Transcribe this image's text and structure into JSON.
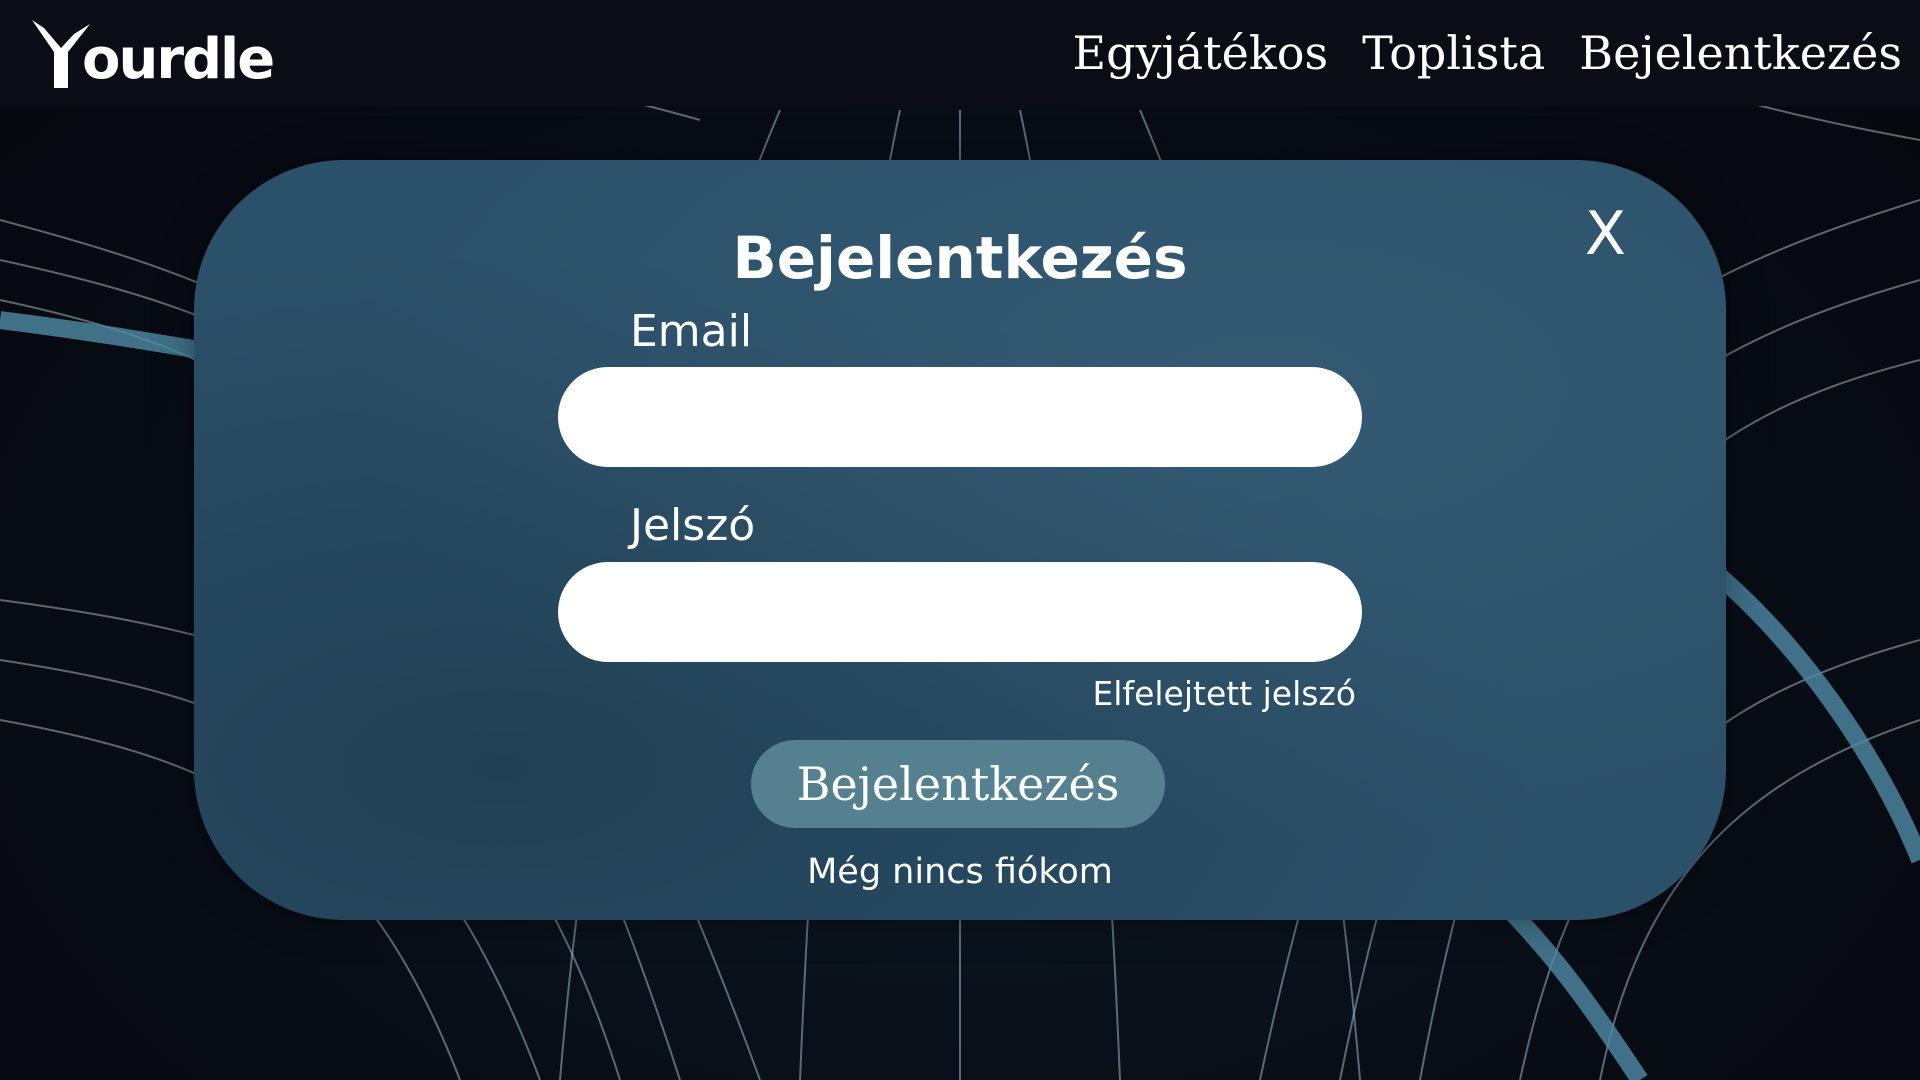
{
  "nav": {
    "logo_text": "ourdle",
    "links": [
      "Egyjátékos",
      "Toplista",
      "Bejelentkezés"
    ]
  },
  "modal": {
    "title": "Bejelentkezés",
    "close_label": "X",
    "email_label": "Email",
    "email_value": "",
    "password_label": "Jelszó",
    "password_value": "",
    "forgot_password": "Elfelejtett jelszó",
    "submit_label": "Bejelentkezés",
    "register_link": "Még nincs fiókom"
  },
  "colors": {
    "modal_bg": "#2b5069",
    "button_bg": "#54808f",
    "nav_bg": "#0a0d15",
    "text": "#ffffff"
  },
  "icons": {
    "logo": "yourdle-y-logo-icon",
    "background": "flowing-lines-background"
  }
}
